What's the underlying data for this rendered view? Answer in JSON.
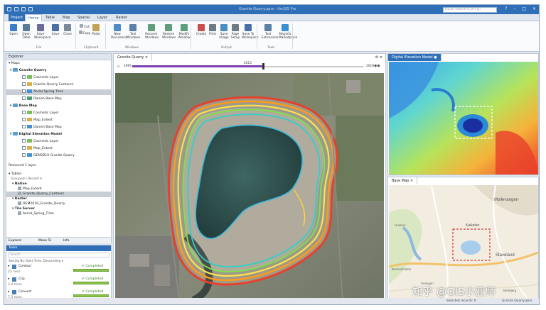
{
  "app": {
    "title": "Granite Quarry.aprx - ArcGIS Pro",
    "search_placeholder": "Quick Search (Ctrl+Q)",
    "window_controls": [
      "?",
      "–",
      "□",
      "×"
    ]
  },
  "ribbon_tabs": [
    "Project",
    "Home",
    "Table",
    "Map",
    "Spatial",
    "Layer",
    "Raster"
  ],
  "ribbon": {
    "buttons": [
      {
        "label": "Open",
        "color": "#3a7dc9"
      },
      {
        "label": "Open Table",
        "color": "#5a7a96"
      },
      {
        "label": "Save Workspace",
        "color": "#6b6b9a"
      },
      {
        "label": "Save",
        "color": "#4a6fa5"
      },
      {
        "label": "Close",
        "color": "#7a8a9b"
      },
      {
        "label": "Cut",
        "color": "#9aa6b2"
      },
      {
        "label": "Copy",
        "color": "#9aa6b2"
      },
      {
        "label": "Paste",
        "color": "#c3a35a"
      },
      {
        "label": "New Document",
        "color": "#4f8bc9"
      },
      {
        "label": "Tool Windows",
        "color": "#5a7fa8"
      },
      {
        "label": "Recover Windows",
        "color": "#5e9e7a"
      },
      {
        "label": "Restore Windows",
        "color": "#5e9e7a"
      },
      {
        "label": "Modify Window",
        "color": "#5e9e7a"
      },
      {
        "label": "Create",
        "color": "#c94f4f"
      },
      {
        "label": "Print",
        "color": "#707a84"
      },
      {
        "label": "Save Image",
        "color": "#4a8fc0"
      },
      {
        "label": "Page Setup",
        "color": "#707a84"
      },
      {
        "label": "Save To Workspace",
        "color": "#4a6fa5"
      },
      {
        "label": "Tool Extensions",
        "color": "#5a7fa8"
      },
      {
        "label": "Mapinfo Marketplace",
        "color": "#3a8fd0"
      }
    ],
    "groups": [
      "File",
      "Clipboard",
      "Windows",
      "Output",
      "Tools"
    ]
  },
  "explorer": {
    "title": "Explorer",
    "section_maps": "Maps",
    "maps": [
      {
        "name": "Granite Quarry",
        "layers": [
          "Cosmetic Layer",
          "Granite Quarry Contours",
          "Aerial Spring Time",
          "Danish Base Map"
        ]
      },
      {
        "name": "Base Map",
        "layers": [
          "Cosmetic Layer",
          "Map_Extent",
          "Danish Base Map"
        ]
      },
      {
        "name": "Digital Elevation Model",
        "layers": [
          "Cosmetic Layer",
          "Map_Extent",
          "DEM2019 Granite Quarry"
        ]
      }
    ],
    "status": "Removed 1 layer",
    "section_tables": "Tables",
    "grouped_by": "Grouped | Recent ▾",
    "table_groups": [
      {
        "name": "Native",
        "items": [
          "Map_Extent",
          "Granite_Quarry_Contours"
        ]
      },
      {
        "name": "Raster",
        "items": [
          "DEM2019_Granite_Quarry"
        ]
      },
      {
        "name": "Tile Server",
        "items": [
          "Aerial_Spring_Time"
        ]
      }
    ],
    "tabs": [
      "Explorer",
      "Move To",
      "Info"
    ]
  },
  "tasks": {
    "title": "Tasks",
    "search_placeholder": "Search",
    "sort_label": "Sorting By: Start Time, Descending ▾",
    "items": [
      {
        "name": "Contour",
        "status": "Completed",
        "duration": "22 secs",
        "progress": 1.0
      },
      {
        "name": "Clip",
        "status": "Completed",
        "duration": "2.4 mins",
        "progress": 1.0
      },
      {
        "name": "Convert",
        "status": "Completed",
        "duration": "7.5 mins",
        "progress": 1.0
      }
    ]
  },
  "center": {
    "tab": "Granite Quarry",
    "timeline_start": "1995",
    "timeline_mid": "2013",
    "timeline_end": "2019"
  },
  "dem": {
    "title": "Digital Elevation Model"
  },
  "basemap": {
    "title": "Base Map",
    "places": [
      "Mollevangen",
      "Kalkeker",
      "Staveland",
      "Bonneshullen",
      "Holmen",
      "Svangen",
      "Stenbjerg"
    ]
  },
  "statusbar": {
    "selected": "Selected records: 0",
    "zoom": "Granite Quarry.aprx"
  },
  "watermark": "知乎 @GIS小亚师",
  "colors": {
    "accent": "#2f6fb8",
    "timeline": "#7a3fb0",
    "extent": "#d43a3a"
  }
}
